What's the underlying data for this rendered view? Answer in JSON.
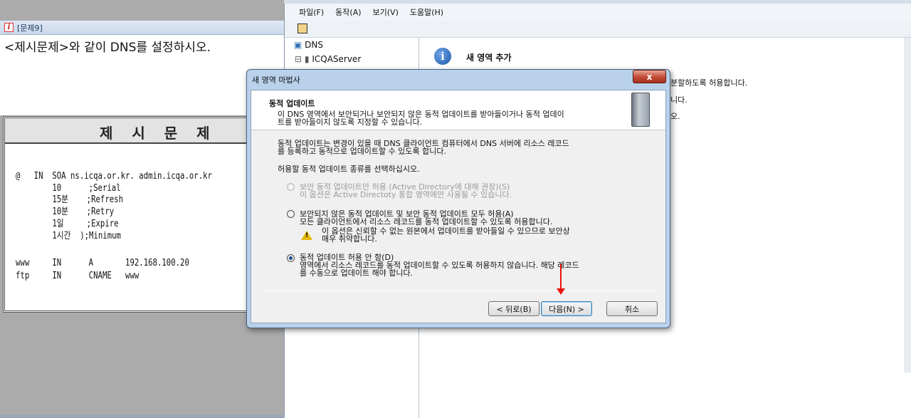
{
  "question": {
    "window_title": "[문제9]",
    "instruction": "<제시문제>와 같이 DNS를 설정하시오.",
    "problem_title": "제 시 문 제",
    "zone_lines": [
      "@   IN  SOA ns.icqa.or.kr. admin.icqa.or.kr",
      "        10      ;Serial",
      "        15분    ;Refresh",
      "        10분    ;Retry",
      "        1일     ;Expire",
      "        1시간  );Minimum"
    ],
    "records": [
      "www     IN      A       192.168.100.20",
      "ftp     IN      CNAME   www"
    ]
  },
  "mmc": {
    "menu": [
      "파일(F)",
      "동작(A)",
      "보기(V)",
      "도움말(H)"
    ],
    "tree": {
      "root": "DNS",
      "server": "ICQAServer",
      "expander": "⊟"
    },
    "detail_heading": "새 영역 추가",
    "detail_fragments": [
      "분할하도록 허용합니다.",
      "니다.",
      "오."
    ]
  },
  "dialog": {
    "title": "새 영역 마법사",
    "close": "x",
    "header_title": "동적 업데이트",
    "header_desc_1": "이 DNS 영역에서 보안되거나 보안되지 않은 동적 업데이트를 받아들이거나 동적 업데이",
    "header_desc_2": "트를 받아들이지 않도록 지정할 수 있습니다.",
    "body_desc_1": "동적 업데이트는 변경이 있을 때 DNS 클라이언트 컴퓨터에서 DNS 서버에 리소스 레코드",
    "body_desc_2": "를 등록하고 동적으로 업데이트할 수 있도록 합니다.",
    "select_prompt": "허용할 동적 업데이트 종류를 선택하십시오.",
    "options": [
      {
        "label": "보안 동적 업데이트만 허용 (Active Directory에 대해 권장)(S)",
        "desc": "이 옵션은 Active Directoty 통합 영역에만 사용될 수 있습니다.",
        "checked": false,
        "disabled": true
      },
      {
        "label": "보안되지 않은 동적 업데이트 및 보안 동적 업데이트 모두 허용(A)",
        "desc": "모든 클라이언트에서 리소스 레코드를 동적 업데이트할 수 있도록 허용합니다.",
        "warn_1": "이 옵션은 신뢰할 수 없는 원본에서 업데이트를 받아들일 수 있으므로 보안상",
        "warn_2": "매우 취약합니다.",
        "checked": false,
        "disabled": false
      },
      {
        "label": "동적 업데이트 허용 안 함(D)",
        "desc_1": "영역에서 리소스 레코드를 동적 업데이트할 수 있도록 허용하지 않습니다. 해당 레코드",
        "desc_2": "를 수동으로 업데이트 해야 합니다.",
        "checked": true,
        "disabled": false
      }
    ],
    "buttons": {
      "back": "< 뒤로(B)",
      "next": "다음(N) >",
      "cancel": "취소"
    },
    "annotation_color": "#e8140c"
  }
}
